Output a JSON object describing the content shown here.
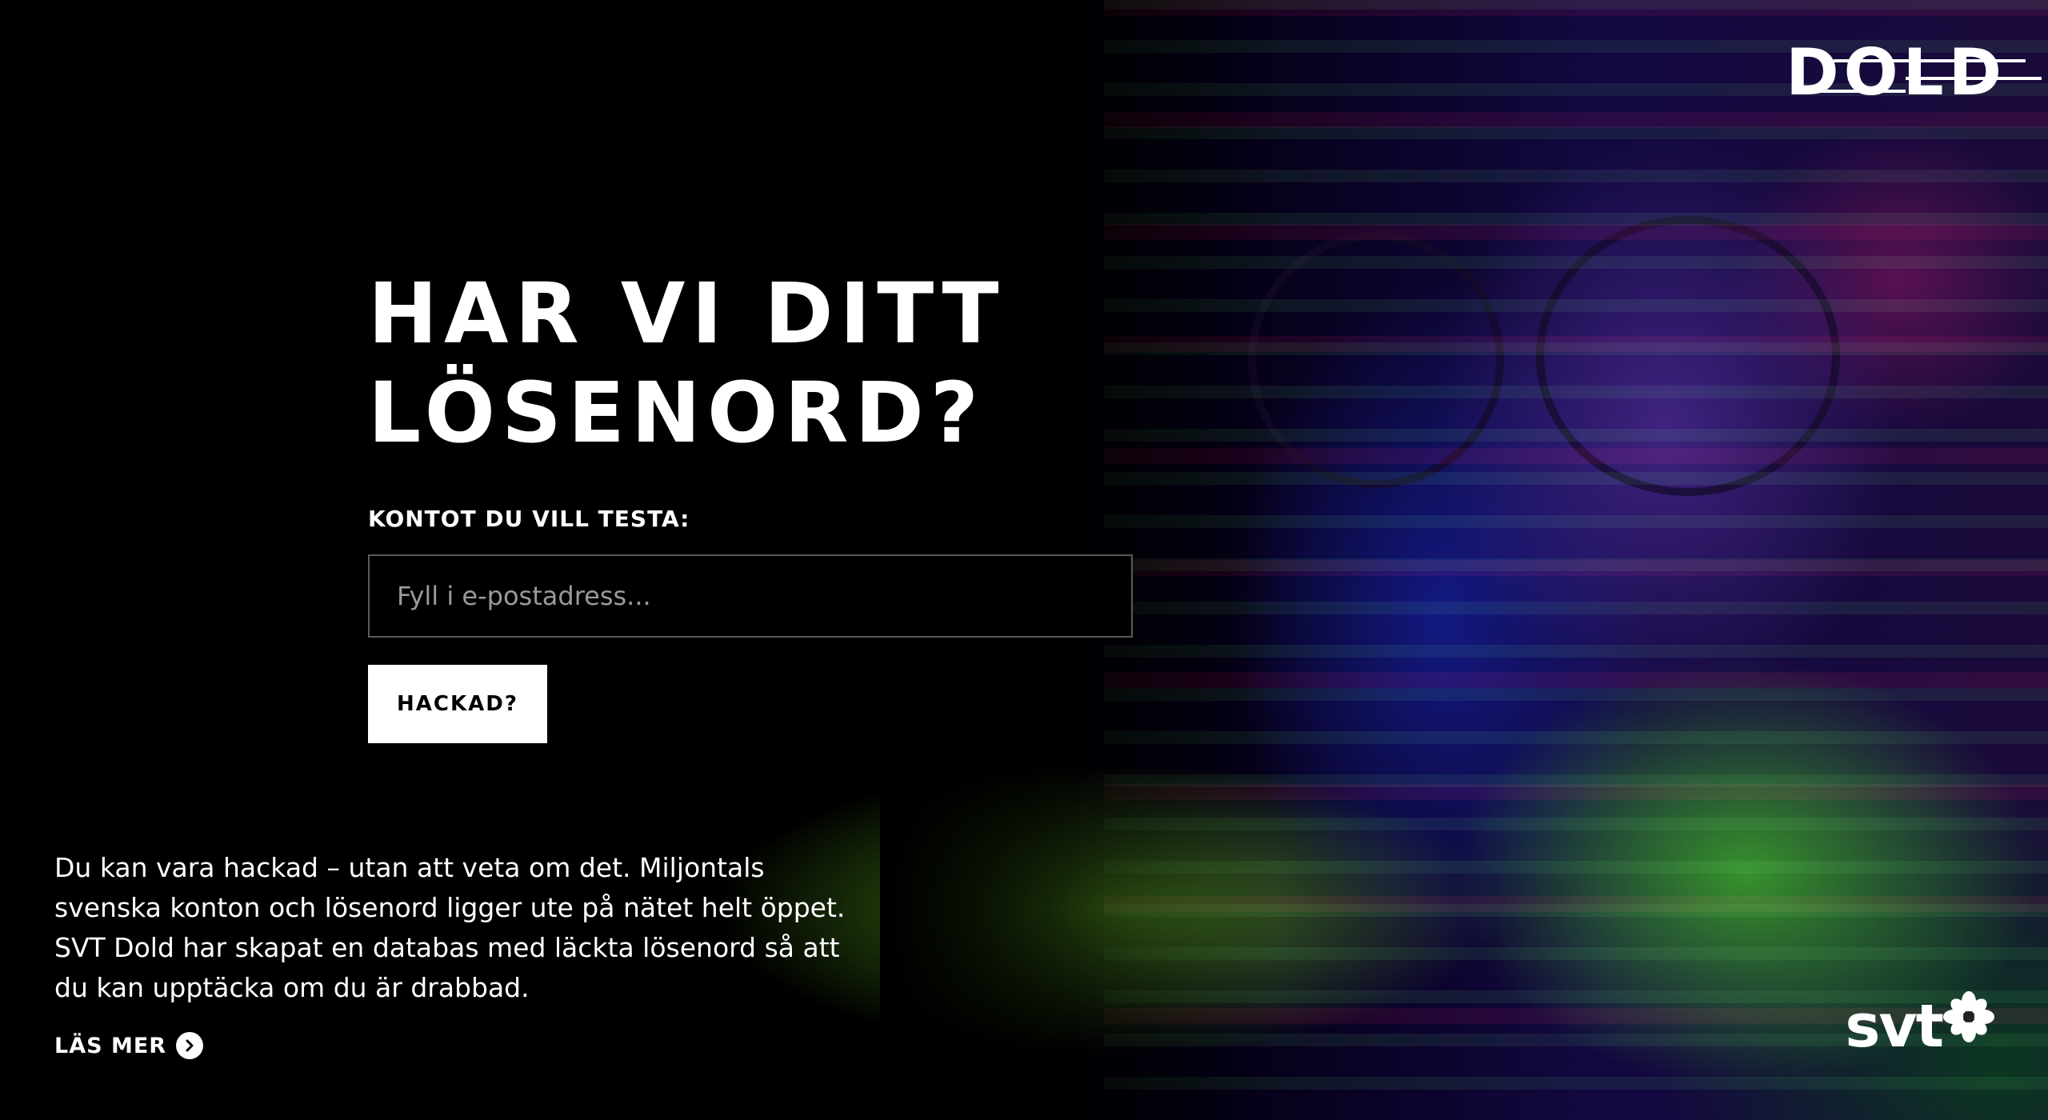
{
  "brand": {
    "logo_text": "DOLD",
    "footer_logo_text": "svt"
  },
  "hero": {
    "headline_line1": "HAR VI DITT",
    "headline_line2": "LÖSENORD?",
    "field_label": "KONTOT DU VILL TESTA:",
    "email_placeholder": "Fyll i e-postadress...",
    "email_value": "",
    "submit_label": "HACKAD?"
  },
  "intro": {
    "text": "Du kan vara hackad – utan att veta om det. Miljontals svenska konton och lösenord ligger ute på nätet helt öppet. SVT Dold har skapat en databas med läckta lösenord så att du kan upptäcka om du är drabbad.",
    "read_more_label": "LÄS MER"
  },
  "icons": {
    "read_more": "chevron-right-circle-icon",
    "svt_mark": "flower-star-icon"
  },
  "colors": {
    "background": "#000000",
    "text": "#ffffff",
    "input_border": "#5a5a5a",
    "button_bg": "#ffffff",
    "button_text": "#000000"
  }
}
